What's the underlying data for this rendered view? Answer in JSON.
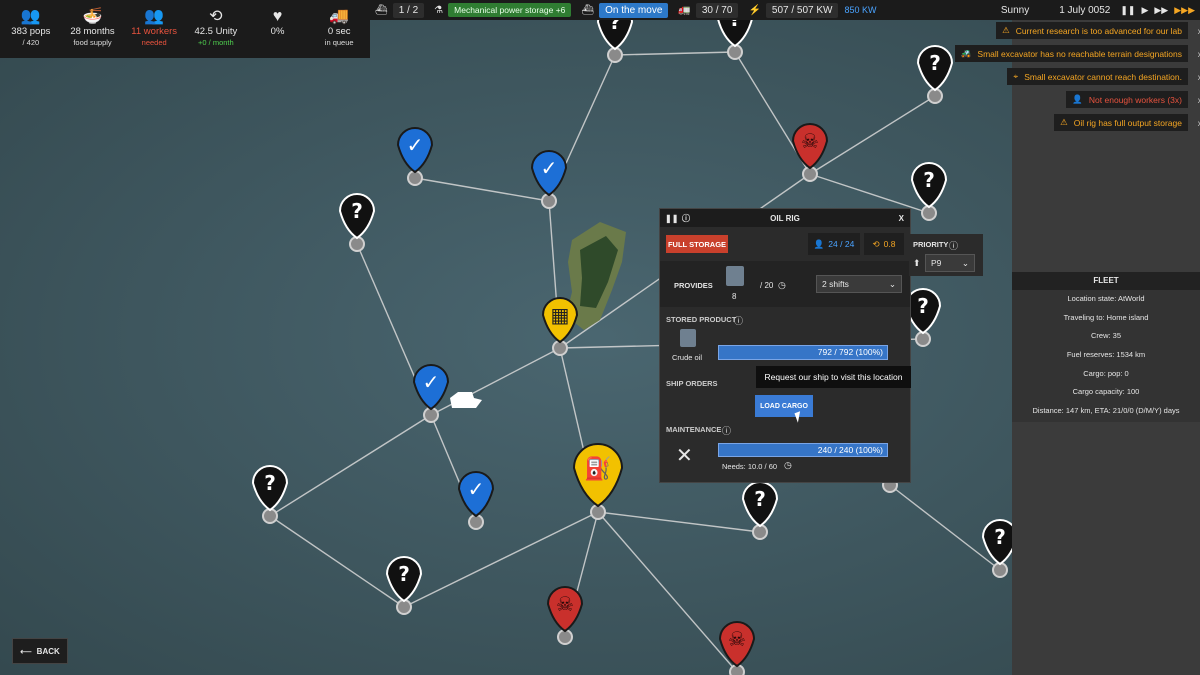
{
  "stats": [
    {
      "icon": "population-icon",
      "value": "383 pops",
      "sub": "/ 420"
    },
    {
      "icon": "food-icon",
      "value": "28 months",
      "sub": "food supply"
    },
    {
      "icon": "workers-icon",
      "value": "11 workers",
      "sub": "needed"
    },
    {
      "icon": "unity-icon",
      "value": "42.5 Unity",
      "sub": "+0 / month"
    },
    {
      "icon": "health-icon",
      "value": "0%",
      "sub": ""
    },
    {
      "icon": "truck-icon",
      "value": "0 sec",
      "sub": "in queue"
    }
  ],
  "topbar": {
    "ships": "1 / 2",
    "research": "Mechanical power storage +6",
    "move_status": "On the move",
    "vehicles": "30 / 70",
    "power": "507 / 507 KW",
    "power_extra": "850 KW",
    "weather": "Sunny",
    "date": "1 July 0052"
  },
  "notifications": [
    {
      "text": "Current research is too advanced for our lab",
      "type": "warn"
    },
    {
      "text": "Small excavator has no reachable terrain designations",
      "type": "warn"
    },
    {
      "text": "Small excavator cannot reach destination.",
      "type": "warn"
    },
    {
      "text": "Not enough workers (3x)",
      "type": "error"
    },
    {
      "text": "Oil rig has full output storage",
      "type": "warn"
    }
  ],
  "panel": {
    "title": "OIL RIG",
    "full_storage": "FULL STORAGE",
    "workers": "24 / 24",
    "unity": "0.8",
    "provides_label": "PROVIDES",
    "provides_amount": "8",
    "provides_per": "/ 20",
    "shifts": "2 shifts",
    "stored_label": "STORED PRODUCT",
    "product_name": "Crude oil",
    "product_bar": "792 / 792 (100%)",
    "product_fill": 1.0,
    "ship_orders_label": "SHIP ORDERS",
    "load_cargo": "LOAD CARGO",
    "maintenance_label": "MAINTENANCE",
    "maint_bar": "240 / 240 (100%)",
    "maint_fill": 1.0,
    "maint_needs": "Needs: 10.0 / 60",
    "close": "X"
  },
  "priority": {
    "label": "PRIORITY",
    "value": "P9"
  },
  "tooltip": "Request our ship to visit this location",
  "fleet": {
    "title": "FLEET",
    "lines": [
      "Location state: AtWorld",
      "Traveling to: Home island",
      "Crew: 35",
      "Fuel reserves: 1534 km",
      "Cargo: pop: 0",
      "Cargo capacity: 100",
      "Distance: 147 km, ETA: 21/0/0 (D/M/Y) days"
    ]
  },
  "back": "BACK",
  "colors": {
    "ocean": "#3e5660",
    "blue_pin": "#1d6fd6",
    "red_pin": "#c9302c",
    "yellow_pin": "#f2c100",
    "unknown_pin": "#111111"
  }
}
